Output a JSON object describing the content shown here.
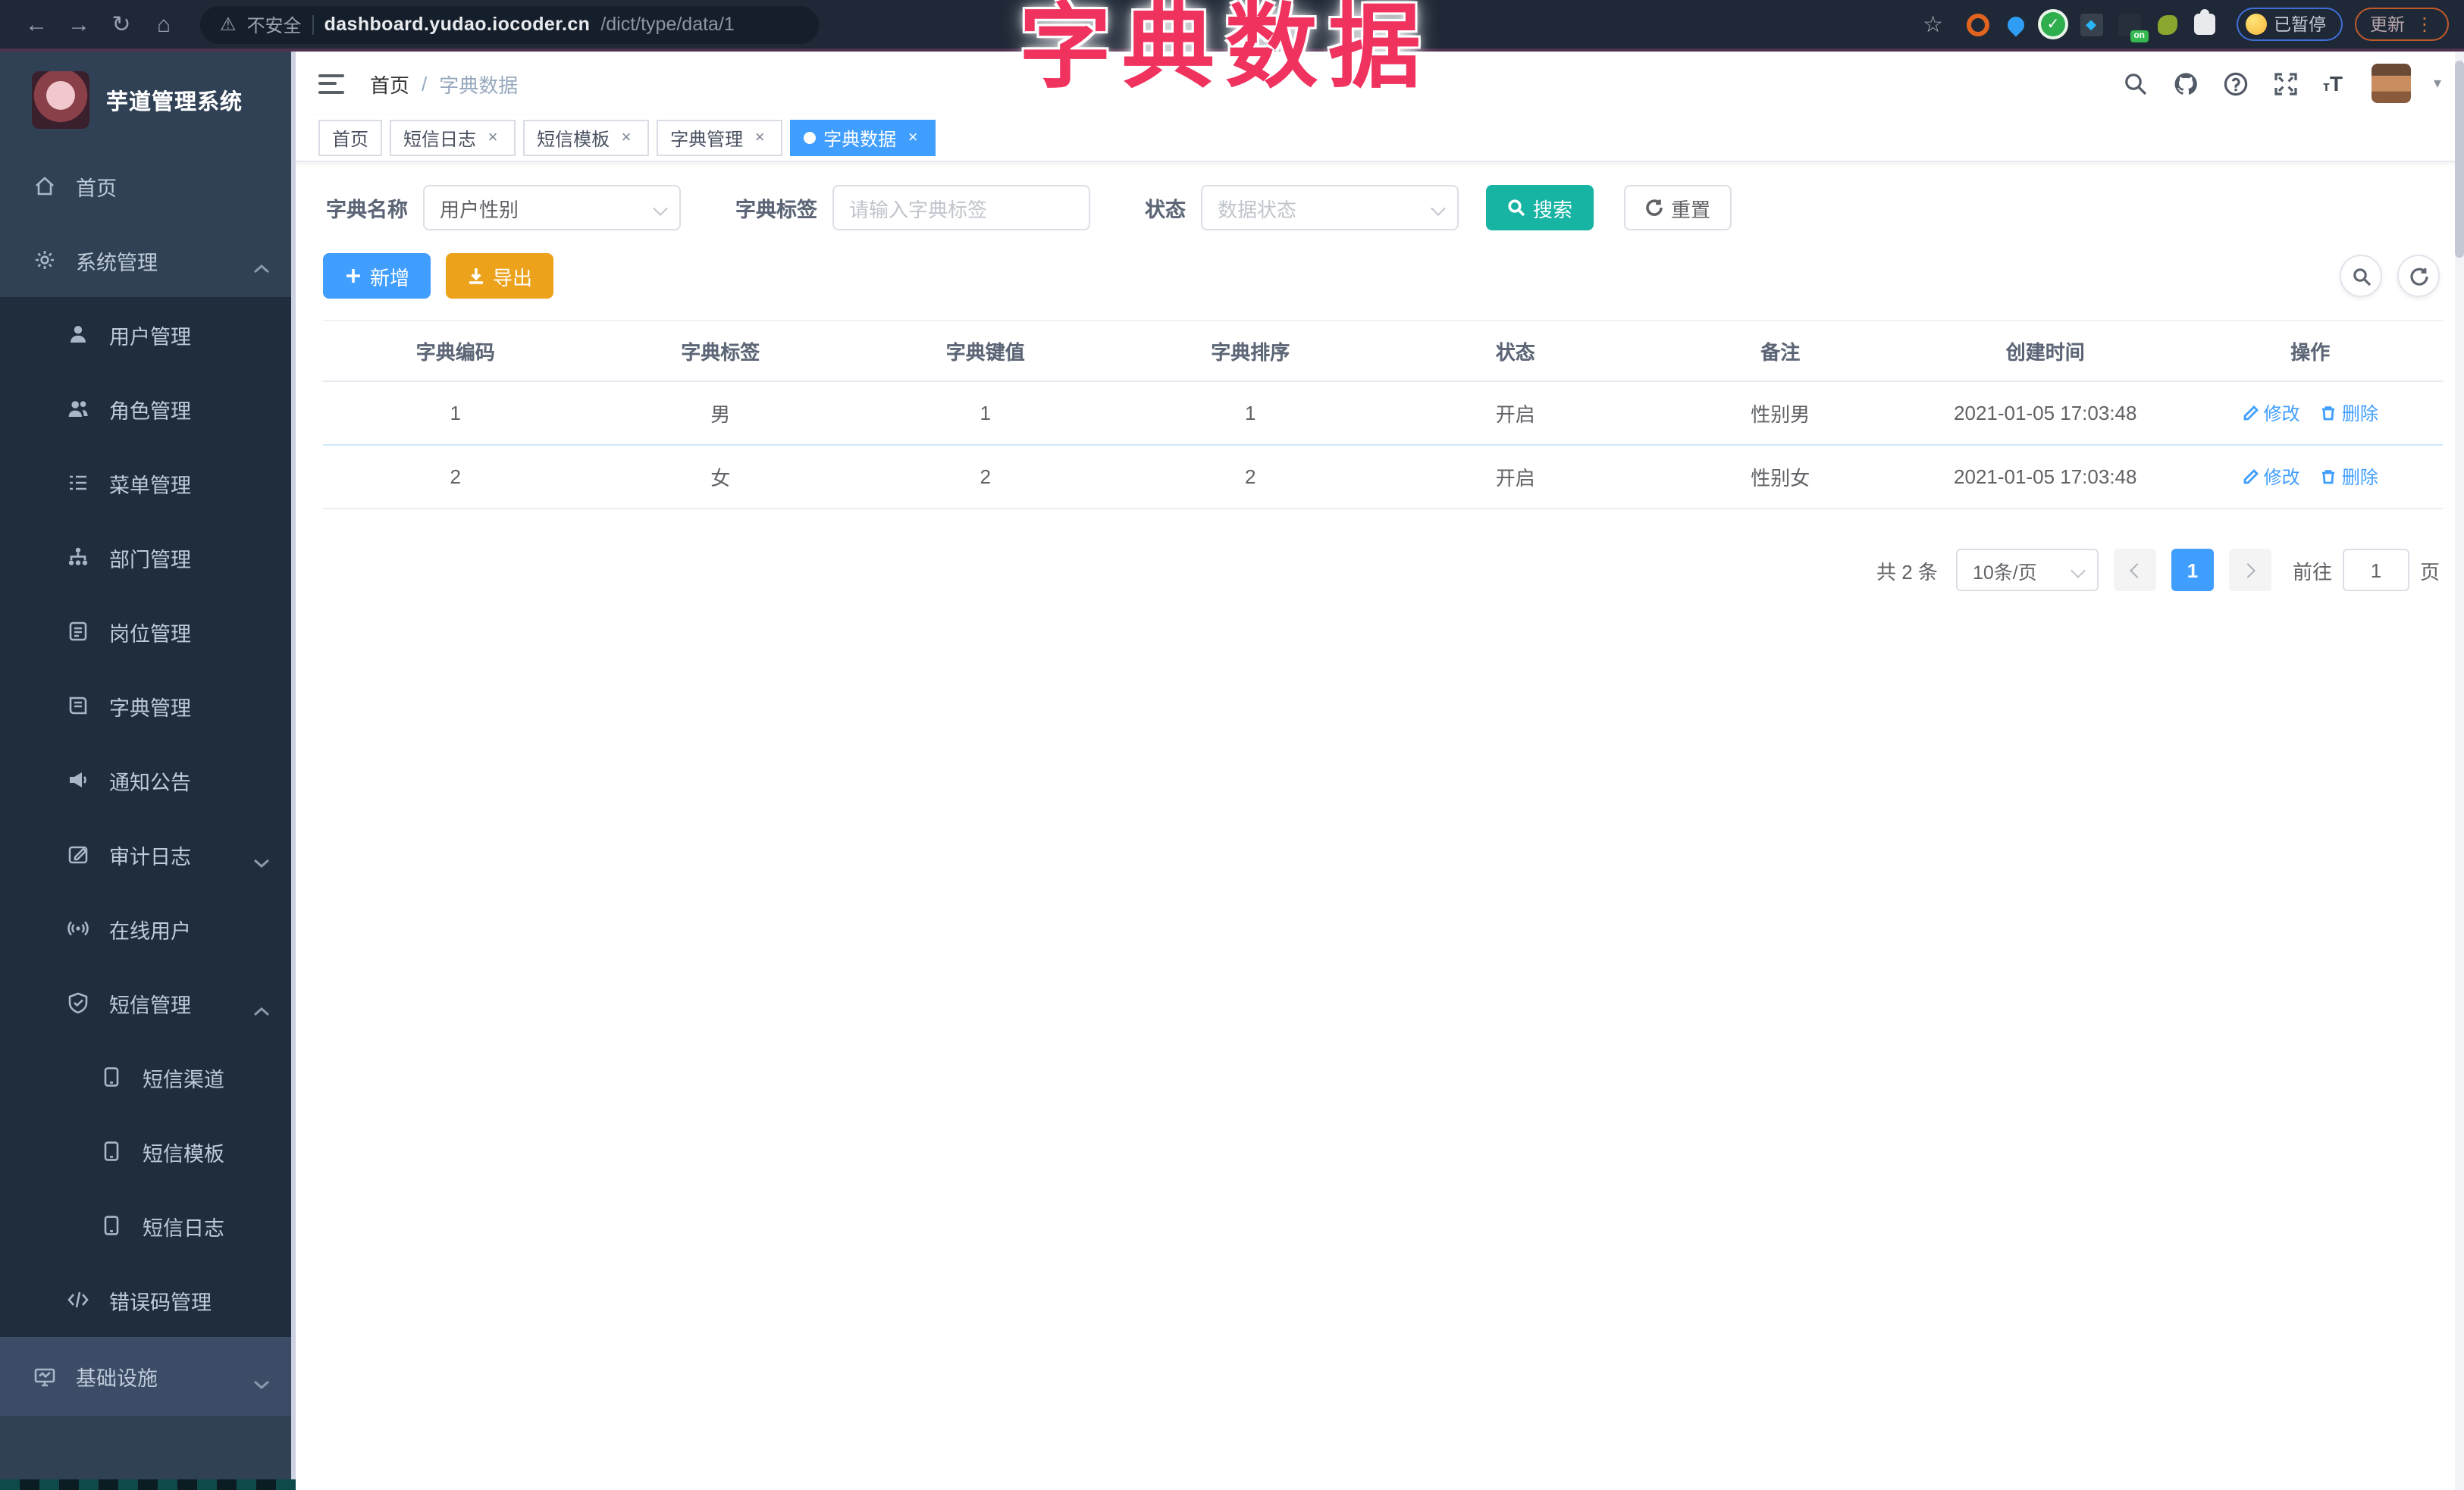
{
  "browser": {
    "security_label": "不安全",
    "url_host": "dashboard.yudao.iocoder.cn",
    "url_path": "/dict/type/data/1",
    "paused_label": "已暂停",
    "update_label": "更新",
    "ext_on_badge": "on"
  },
  "overlay": {
    "title": "字典数据"
  },
  "sidebar": {
    "logo_text": "芋道管理系统",
    "items": [
      {
        "label": "首页",
        "icon": "home-icon"
      },
      {
        "label": "系统管理",
        "icon": "gear-icon",
        "state": "expanded"
      },
      {
        "label": "用户管理",
        "icon": "user-icon"
      },
      {
        "label": "角色管理",
        "icon": "users-icon"
      },
      {
        "label": "菜单管理",
        "icon": "menu-list-icon"
      },
      {
        "label": "部门管理",
        "icon": "org-tree-icon"
      },
      {
        "label": "岗位管理",
        "icon": "badge-icon"
      },
      {
        "label": "字典管理",
        "icon": "book-icon"
      },
      {
        "label": "通知公告",
        "icon": "megaphone-icon"
      },
      {
        "label": "审计日志",
        "icon": "audit-icon",
        "state": "collapsed"
      },
      {
        "label": "在线用户",
        "icon": "online-icon"
      },
      {
        "label": "短信管理",
        "icon": "shield-icon",
        "state": "expanded"
      },
      {
        "label": "短信渠道",
        "icon": "phone-icon"
      },
      {
        "label": "短信模板",
        "icon": "phone-icon"
      },
      {
        "label": "短信日志",
        "icon": "phone-icon"
      },
      {
        "label": "错误码管理",
        "icon": "code-icon"
      },
      {
        "label": "基础设施",
        "icon": "monitor-icon",
        "state": "collapsed"
      }
    ]
  },
  "header": {
    "breadcrumb_home": "首页",
    "breadcrumb_sep": "/",
    "breadcrumb_current": "字典数据"
  },
  "tabs": [
    {
      "label": "首页"
    },
    {
      "label": "短信日志"
    },
    {
      "label": "短信模板"
    },
    {
      "label": "字典管理"
    },
    {
      "label": "字典数据",
      "active": true
    }
  ],
  "filter": {
    "name_label": "字典名称",
    "name_value": "用户性别",
    "tag_label": "字典标签",
    "tag_placeholder": "请输入字典标签",
    "status_label": "状态",
    "status_placeholder": "数据状态",
    "search_label": "搜索",
    "reset_label": "重置"
  },
  "toolbar": {
    "add_label": "新增",
    "export_label": "导出"
  },
  "table": {
    "columns": [
      "字典编码",
      "字典标签",
      "字典键值",
      "字典排序",
      "状态",
      "备注",
      "创建时间",
      "操作"
    ],
    "edit_label": "修改",
    "delete_label": "删除",
    "rows": [
      {
        "code": "1",
        "tag": "男",
        "value": "1",
        "sort": "1",
        "status": "开启",
        "remark": "性别男",
        "created": "2021-01-05 17:03:48"
      },
      {
        "code": "2",
        "tag": "女",
        "value": "2",
        "sort": "2",
        "status": "开启",
        "remark": "性别女",
        "created": "2021-01-05 17:03:48"
      }
    ]
  },
  "pagination": {
    "total_text": "共 2 条",
    "page_size": "10条/页",
    "current_page": "1",
    "goto_label": "前往",
    "goto_value": "1",
    "page_suffix": "页"
  },
  "colors": {
    "primary": "#409eff",
    "teal": "#17b3a3",
    "warning": "#eda21c",
    "annotation_pink": "#f0325f",
    "sidebar_bg": "#304156",
    "submenu_bg": "#1f2d3d"
  }
}
